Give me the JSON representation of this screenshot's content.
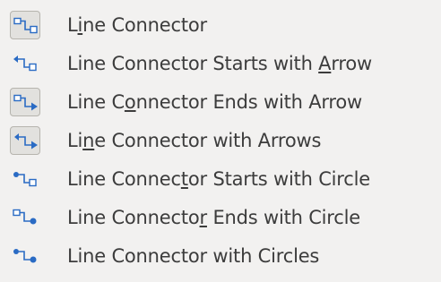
{
  "menu": {
    "items": [
      {
        "pre": "L",
        "mn": "i",
        "post": "ne Connector",
        "icon": "line-connector-icon",
        "checked": true
      },
      {
        "pre": "Line Connector Starts with ",
        "mn": "A",
        "post": "rrow",
        "icon": "line-connector-starts-arrow-icon",
        "checked": false
      },
      {
        "pre": "Line C",
        "mn": "o",
        "post": "nnector Ends with Arrow",
        "icon": "line-connector-ends-arrow-icon",
        "checked": true
      },
      {
        "pre": "Li",
        "mn": "n",
        "post": "e Connector with Arrows",
        "icon": "line-connector-arrows-icon",
        "checked": true
      },
      {
        "pre": "Line Connec",
        "mn": "t",
        "post": "or Starts with Circle",
        "icon": "line-connector-starts-circle-icon",
        "checked": false
      },
      {
        "pre": "Line Connecto",
        "mn": "r",
        "post": " Ends with Circle",
        "icon": "line-connector-ends-circle-icon",
        "checked": false
      },
      {
        "pre": "Line Connector with Circles",
        "mn": "",
        "post": "",
        "icon": "line-connector-circles-icon",
        "checked": false
      }
    ],
    "colors": {
      "icon_blue": "#2a6bc4",
      "text": "#3c3c3c",
      "checked_bg": "#e2e1de"
    }
  }
}
